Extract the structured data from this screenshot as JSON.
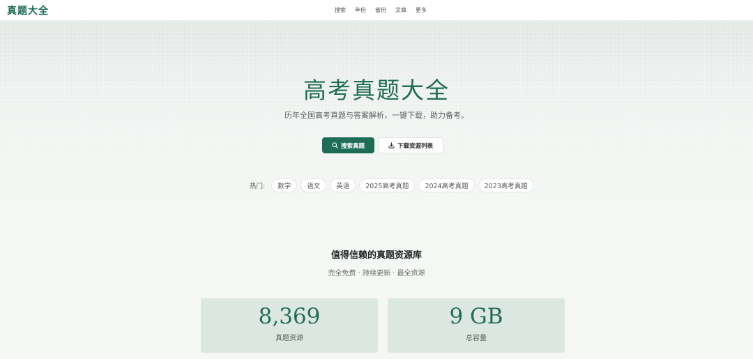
{
  "logo": "真题大全",
  "nav": [
    "搜索",
    "年份",
    "省份",
    "文章",
    "更多"
  ],
  "hero": {
    "title": "高考真题大全",
    "subtitle": "历年全国高考真题与答案解析，一键下载，助力备考。",
    "primary_button": "搜索真题",
    "secondary_button": "下载资源列表"
  },
  "hot": {
    "label": "热门:",
    "tags": [
      "数学",
      "语文",
      "英语",
      "2025高考真题",
      "2024高考真题",
      "2023高考真题"
    ]
  },
  "section": {
    "title": "值得信赖的真题资源库",
    "subtitle": "完全免费 · 持续更新 · 最全资源"
  },
  "stats": [
    {
      "value": "8,369",
      "label": "真题资源"
    },
    {
      "value": "9 GB",
      "label": "总容量"
    }
  ],
  "colors": {
    "accent": "#1f6d57",
    "card": "#dde7e2"
  },
  "icons": {
    "search": "search-icon",
    "download": "download-icon"
  }
}
